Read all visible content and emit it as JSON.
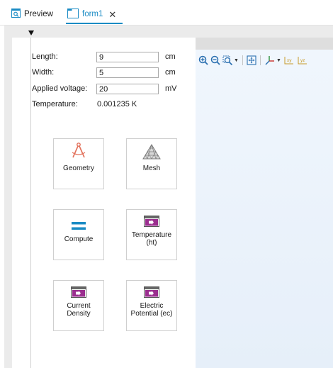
{
  "tabs": [
    {
      "label": "Preview",
      "icon": "preview-icon"
    },
    {
      "label": "form1",
      "icon": "form-icon",
      "active": true,
      "close": "✕"
    }
  ],
  "form": {
    "fields": [
      {
        "label": "Length:",
        "value": "9",
        "unit": "cm"
      },
      {
        "label": "Width:",
        "value": "5",
        "unit": "cm"
      },
      {
        "label": "Applied voltage:",
        "value": "20",
        "unit": "mV"
      }
    ],
    "temperature": {
      "label": "Temperature:",
      "value": "0.001235 K"
    }
  },
  "buttons": {
    "geometry": {
      "label": "Geometry",
      "icon": "geometry-compass-icon"
    },
    "mesh": {
      "label": "Mesh",
      "icon": "mesh-triangle-icon"
    },
    "compute": {
      "label": "Compute",
      "icon": "equals-icon"
    },
    "temperature": {
      "label": "Temperature (ht)",
      "icon": "plot-window-icon"
    },
    "current_density": {
      "label": "Current Density",
      "icon": "plot-window-icon"
    },
    "electric_potential": {
      "label": "Electric Potential (ec)",
      "icon": "plot-window-icon"
    }
  },
  "graphics_toolbar": {
    "icons": [
      "zoom-in-icon",
      "zoom-out-icon",
      "zoom-box-icon",
      "zoom-extents-icon",
      "axes-orientation-icon",
      "xy-view-icon",
      "yz-view-icon"
    ],
    "xy_label": "xy",
    "yz_label": "yz"
  },
  "colors": {
    "accent": "#1a8bc4",
    "geometry": "#e2705a",
    "mesh": "#8a8a8a",
    "compute": "#1a8bc4",
    "plot": "#9b2e8f"
  }
}
